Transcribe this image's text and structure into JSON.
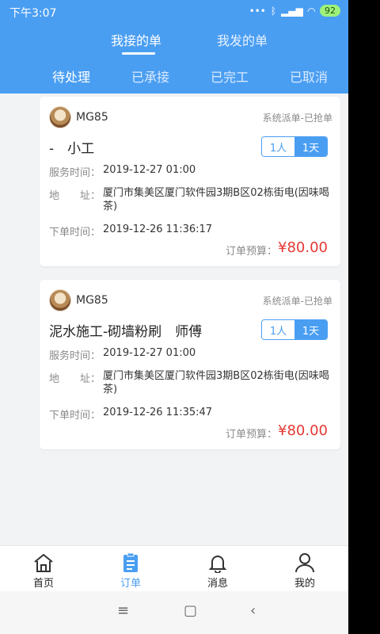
{
  "status_bar": {
    "time": "下午3:07",
    "battery": "92"
  },
  "top_tabs": [
    {
      "label": "我接的单"
    },
    {
      "label": "我发的单"
    }
  ],
  "sub_tabs": [
    {
      "label": "待处理"
    },
    {
      "label": "已承接"
    },
    {
      "label": "已完工"
    },
    {
      "label": "已取消"
    }
  ],
  "orders": [
    {
      "user": "MG85",
      "status": "系统派单-已抢单",
      "title": "-　小工",
      "people": "1人",
      "days": "1天",
      "service_time_label": "服务时间：",
      "service_time": "2019-12-27 01:00",
      "address_label": "地　　址：",
      "address": "厦门市集美区厦门软件园3期B区02栋街电(因味喝茶)",
      "order_time_label": "下单时间：",
      "order_time": "2019-12-26 11:36:17",
      "budget_label": "订单预算：",
      "budget": "¥80.00"
    },
    {
      "user": "MG85",
      "status": "系统派单-已抢单",
      "title": "泥水施工-砌墙粉刷　师傅",
      "people": "1人",
      "days": "1天",
      "service_time_label": "服务时间：",
      "service_time": "2019-12-27 01:00",
      "address_label": "地　　址：",
      "address": "厦门市集美区厦门软件园3期B区02栋街电(因味喝茶)",
      "order_time_label": "下单时间：",
      "order_time": "2019-12-26 11:35:47",
      "budget_label": "订单预算：",
      "budget": "¥80.00"
    }
  ],
  "bottom_nav": [
    {
      "label": "首页",
      "icon": "home-icon"
    },
    {
      "label": "订单",
      "icon": "clipboard-icon"
    },
    {
      "label": "消息",
      "icon": "bell-icon"
    },
    {
      "label": "我的",
      "icon": "user-icon"
    }
  ],
  "colors": {
    "accent": "#4a9ef2",
    "price": "#e53935"
  }
}
